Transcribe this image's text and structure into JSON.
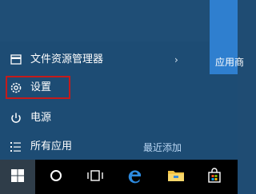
{
  "start_menu": {
    "items": [
      {
        "label": "文件资源管理器",
        "icon": "folder-explorer-icon",
        "chevron": "›"
      },
      {
        "label": "设置",
        "icon": "gear-icon"
      },
      {
        "label": "电源",
        "icon": "power-icon"
      },
      {
        "label": "所有应用",
        "icon": "list-icon"
      }
    ],
    "recent_label": "最近添加",
    "tile_label": "应用商",
    "highlight_color": "#c41b1b"
  },
  "colors": {
    "menu_bg": "#1d4c74",
    "tile_accent": "#2f7fcf",
    "taskbar_bg": "#000000",
    "link_blue": "#b9d6f3"
  },
  "taskbar": {
    "buttons": [
      "windows-logo-icon",
      "cortana-circle-icon",
      "task-view-icon",
      "edge-icon",
      "file-explorer-icon",
      "store-icon"
    ]
  }
}
